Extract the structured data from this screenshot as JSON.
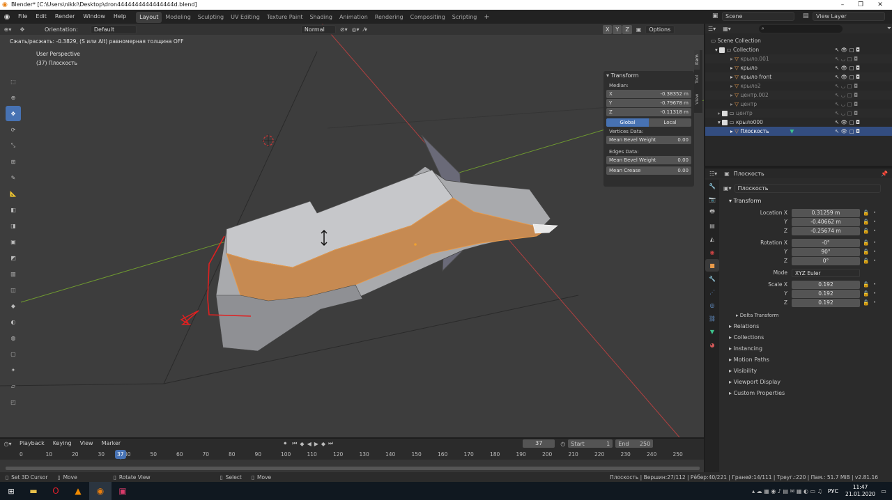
{
  "window": {
    "title": "Blender* [C:\\Users\\nikki\\Desktop\\dron4444444444444444d.blend]",
    "controls": [
      "–",
      "❐",
      "✕"
    ]
  },
  "menu": [
    "File",
    "Edit",
    "Render",
    "Window",
    "Help"
  ],
  "workspaces": [
    "Layout",
    "Modeling",
    "Sculpting",
    "UV Editing",
    "Texture Paint",
    "Shading",
    "Animation",
    "Rendering",
    "Compositing",
    "Scripting"
  ],
  "scene": {
    "name": "Scene",
    "view_layer": "View Layer"
  },
  "viewport_header": {
    "orientation_label": "Orientation:",
    "orientation_value": "Default",
    "pivot": "Normal",
    "options": "Options",
    "axes": [
      "X",
      "Y",
      "Z"
    ]
  },
  "operator_hint": "Сжать/расжать: -0.3829, (S или Alt) равномерная толщина OFF",
  "overlay": {
    "view_name": "User Perspective",
    "object_info": "(37) Плоскость"
  },
  "npanel": {
    "title": "Transform",
    "median": "Median:",
    "x_label": "X",
    "x": "-0.38352 m",
    "y_label": "Y",
    "y": "-0.79678 m",
    "z_label": "Z",
    "z": "-0.11318 m",
    "global": "Global",
    "local": "Local",
    "vertices_data": "Vertices Data:",
    "mean_bevel_weight": "Mean Bevel Weight",
    "mbw_v": "0.00",
    "edges_data": "Edges Data:",
    "mean_bevel_weight_e": "Mean Bevel Weight",
    "mbw_e": "0.00",
    "mean_crease": "Mean Crease",
    "mc": "0.00",
    "tabs": [
      "Item",
      "Tool",
      "View"
    ]
  },
  "outliner": {
    "root": "Scene Collection",
    "items": [
      {
        "name": "Collection"
      },
      {
        "name": "крыло.001"
      },
      {
        "name": "крыло"
      },
      {
        "name": "крыло front"
      },
      {
        "name": "крыло2"
      },
      {
        "name": "центр.002"
      },
      {
        "name": "центр"
      },
      {
        "name": "центр"
      },
      {
        "name": "крыло000"
      },
      {
        "name": "Плоскость"
      }
    ]
  },
  "properties": {
    "object_name": "Плоскость",
    "object_field": "Плоскость",
    "transform": "Transform",
    "location_label": "Location X",
    "loc_x": "0.31259 m",
    "loc_y": "-0.40662 m",
    "loc_z": "-0.25674 m",
    "rotation_label": "Rotation X",
    "rot_x": "-0°",
    "rot_y": "90°",
    "rot_z": "0°",
    "mode_label": "Mode",
    "mode": "XYZ Euler",
    "scale_label": "Scale X",
    "sc_x": "0.192",
    "sc_y": "0.192",
    "sc_z": "0.192",
    "y_label": "Y",
    "z_label": "Z",
    "delta": "Delta Transform",
    "sections": [
      "Relations",
      "Collections",
      "Instancing",
      "Motion Paths",
      "Visibility",
      "Viewport Display",
      "Custom Properties"
    ]
  },
  "timeline": {
    "menus": [
      "Playback",
      "Keying",
      "View",
      "Marker"
    ],
    "current_frame": "37",
    "start_label": "Start",
    "start": "1",
    "end_label": "End",
    "end": "250",
    "ticks": [
      "0",
      "10",
      "20",
      "30",
      "40",
      "50",
      "60",
      "70",
      "80",
      "90",
      "100",
      "110",
      "120",
      "130",
      "140",
      "150",
      "160",
      "170",
      "180",
      "190",
      "200",
      "210",
      "220",
      "230",
      "240",
      "250"
    ]
  },
  "statusbar": {
    "left": [
      "Set 3D Cursor",
      "Move",
      "Rotate View",
      "Select",
      "Move"
    ],
    "right": "Плоскость | Вершин:27/112 | Рёбер:40/221 | Граней:14/111 | Треуг.:220 | Пам.: 51.7 MiB | v2.81.16"
  },
  "taskbar": {
    "lang": "РУС",
    "time": "11:47",
    "date": "21.01.2020"
  }
}
